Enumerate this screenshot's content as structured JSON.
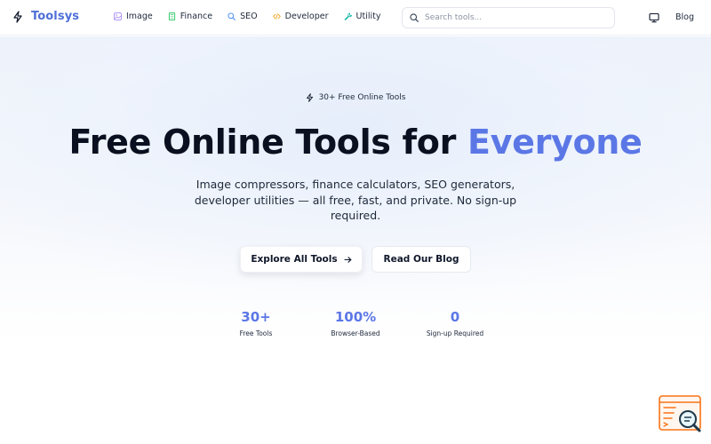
{
  "header": {
    "logo_icon": "bolt-icon",
    "brand": "Toolsys",
    "nav": [
      {
        "label": "Image",
        "icon": "image-icon"
      },
      {
        "label": "Finance",
        "icon": "calculator-icon"
      },
      {
        "label": "SEO",
        "icon": "search-icon"
      },
      {
        "label": "Developer",
        "icon": "code-icon"
      },
      {
        "label": "Utility",
        "icon": "wrench-icon"
      }
    ],
    "search": {
      "placeholder": "Search tools...",
      "value": ""
    },
    "theme_icon": "monitor-icon",
    "blog_label": "Blog"
  },
  "hero": {
    "badge": "30+ Free Online Tools",
    "title_main": "Free Online Tools for ",
    "title_accent": "Everyone",
    "subtitle": "Image compressors, finance calculators, SEO generators, developer utilities — all free, fast, and private. No sign-up required.",
    "primary_button": "Explore All Tools",
    "secondary_button": "Read Our Blog"
  },
  "stats": [
    {
      "value": "30+",
      "label": "Free Tools"
    },
    {
      "value": "100%",
      "label": "Browser-Based"
    },
    {
      "value": "0",
      "label": "Sign-up Required"
    }
  ],
  "colors": {
    "brand": "#4f6fd8",
    "accent": "#5b77e6",
    "nav_image": "#a78bfa",
    "nav_finance": "#22c55e",
    "nav_seo": "#3b82f6",
    "nav_developer": "#f59e0b",
    "nav_utility": "#14b8a6",
    "widget": "#f97316"
  }
}
